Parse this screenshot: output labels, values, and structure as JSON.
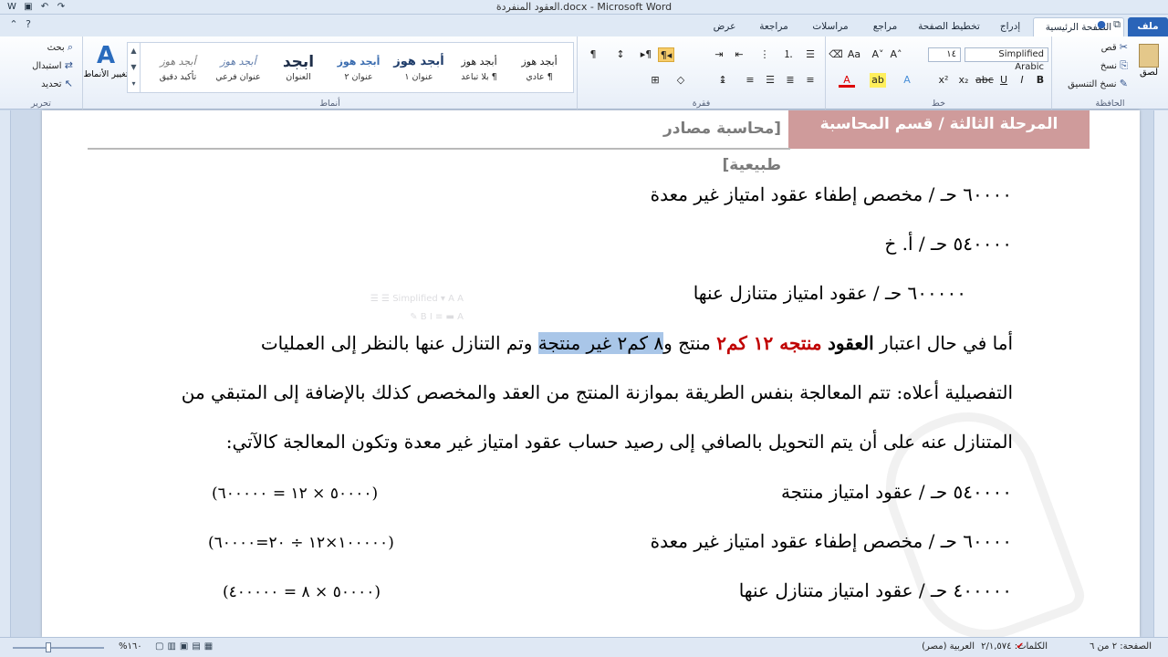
{
  "window": {
    "title": "العقود المنفردة.docx - Microsoft Word"
  },
  "tabs": {
    "file": "ملف",
    "home": "الصفحة الرئيسية",
    "insert": "إدراج",
    "layout": "تخطيط الصفحة",
    "references": "مراجع",
    "mailings": "مراسلات",
    "review": "مراجعة",
    "view": "عرض"
  },
  "ribbon": {
    "clipboard": {
      "label": "الحافظة",
      "paste": "لصق",
      "cut": "قص",
      "copy": "نسخ",
      "format_painter": "نسخ التنسيق"
    },
    "font": {
      "label": "خط",
      "name": "Simplified Arabic",
      "size": "١٤"
    },
    "paragraph": {
      "label": "فقرة"
    },
    "styles": {
      "label": "أنماط",
      "items": [
        {
          "sample": "أبجد هوز",
          "name": "¶ عادي"
        },
        {
          "sample": "أبجد هوز",
          "name": "¶ بلا تباعد"
        },
        {
          "sample": "أبجد هوز",
          "name": "عنوان ١"
        },
        {
          "sample": "أبجد هوز",
          "name": "عنوان ٢"
        },
        {
          "sample": "ابجد",
          "name": "العنوان"
        },
        {
          "sample": "أبجد هوز",
          "name": "عنوان فرعي"
        },
        {
          "sample": "أبجد هوز",
          "name": "تأكيد دقيق"
        }
      ],
      "change_styles": "تغيير الأنماط"
    },
    "editing": {
      "label": "تحرير",
      "find": "بحث",
      "replace": "استبدال",
      "select": "تحديد"
    }
  },
  "document": {
    "header_right": "المرحلة الثالثة / قسم المحاسبة",
    "header_left": "[محاسبة مصادر طبيعية]",
    "lines": [
      "٦٠٠٠٠ حـ / مخصص إطفاء عقود امتياز غير معدة",
      "٥٤٠٠٠٠ حـ / أ. خ",
      "٦٠٠٠٠٠ حـ / عقود امتياز متنازل عنها"
    ],
    "para1": {
      "p1": "أما في حال اعتبار ",
      "p2": "العقود",
      "p3": " ",
      "p4": "منتجه ١٢ كم٢",
      "p5": " منتج و",
      "p6": "٨ كم٢ غير منتجة",
      "p7": " وتم التنازل عنها بالنظر إلى العمليات"
    },
    "para2": "التفصيلية أعلاه: تتم المعالجة بنفس الطريقة بموازنة المنتج من العقد والمخصص كذلك بالإضافة إلى المتبقي من",
    "para3": "المتنازل عنه على أن يتم التحويل بالصافي إلى رصيد حساب عقود امتياز غير معدة وتكون المعالجة كالآتي:",
    "entries": [
      {
        "text": "٥٤٠٠٠٠ حـ / عقود امتياز منتجة",
        "calc": "(٥٠٠٠٠ × ١٢ = ٦٠٠٠٠٠)"
      },
      {
        "text": "٦٠٠٠٠ حـ / مخصص إطفاء عقود امتياز غير معدة",
        "calc": "(١٠٠٠٠٠×١٢ ÷ ٢٠=٦٠٠٠٠)"
      },
      {
        "text": "٤٠٠٠٠٠ حـ / عقود امتياز متنازل عنها",
        "calc": "(٥٠٠٠٠ × ٨ = ٤٠٠٠٠٠)"
      }
    ]
  },
  "statusbar": {
    "page": "الصفحة: ٢ من ٦",
    "words": "الكلمات: ٢/١,٥٧٤",
    "language": "العربية (مصر)",
    "zoom": "١٦٠%"
  }
}
